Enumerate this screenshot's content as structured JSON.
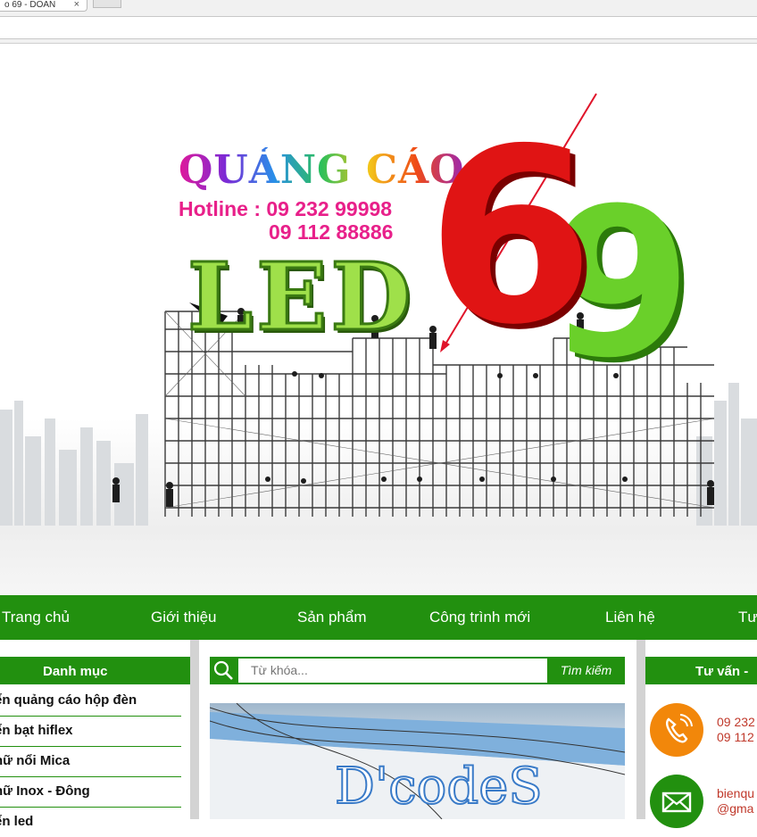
{
  "browser": {
    "tab_title": "o 69 - DOAN",
    "tab_close": "×"
  },
  "banner": {
    "brand_top": "QUẢNG CÁO",
    "hotline_line1": "Hotline : 09 232 99998",
    "hotline_line2": "09 112 88886",
    "brand_main": "LED",
    "digit_six": "6",
    "digit_nine": "9"
  },
  "nav": {
    "items": [
      "Trang chủ",
      "Giới thiệu",
      "Sản phẩm",
      "Công trình mới",
      "Liên hệ",
      "Tư"
    ]
  },
  "sidebar": {
    "title": "Danh mục",
    "items": [
      "ển quảng cáo hộp đèn",
      "ển bạt hiflex",
      "hữ nổi Mica",
      "hữ Inox - Đông",
      "ển led"
    ]
  },
  "search": {
    "placeholder": "Từ khóa...",
    "button": "Tìm kiếm"
  },
  "right": {
    "title": "Tư vấn -",
    "phone1": "09 232",
    "phone2": "09 112",
    "email1": "bienqu",
    "email2": "@gma"
  },
  "colors": {
    "green": "#22900f",
    "orange": "#f2870a",
    "phone_text": "#c0392b"
  }
}
